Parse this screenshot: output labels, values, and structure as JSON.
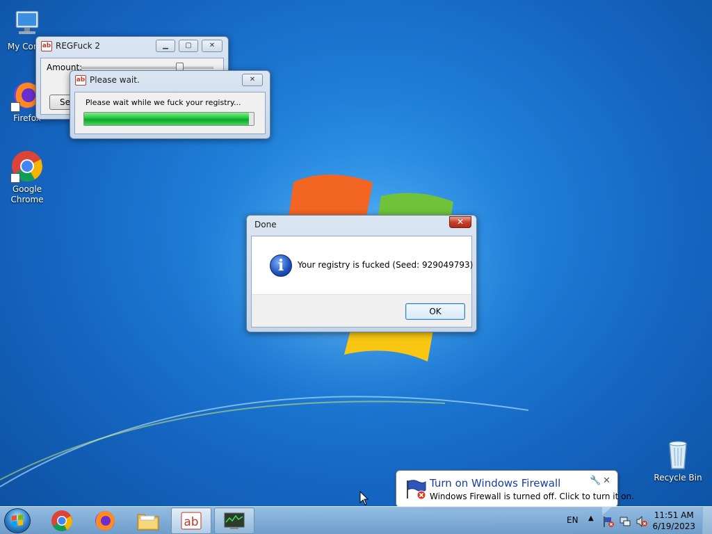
{
  "desktop": {
    "icons": [
      {
        "label": "My Comp",
        "icon": "computer-icon"
      },
      {
        "label": "Firefox",
        "icon": "firefox-icon"
      },
      {
        "label": "Google Chrome",
        "icon": "chrome-icon"
      },
      {
        "label": "Recycle Bin",
        "icon": "recycle-bin-icon"
      }
    ]
  },
  "regfuck_window": {
    "title": "REGFuck 2",
    "amount_label": "Amount:",
    "amount_level": 0.74,
    "settings_button": "Sett"
  },
  "please_wait_window": {
    "title": "Please wait.",
    "message": "Please wait while we fuck your registry...",
    "progress": 0.97
  },
  "done_dialog": {
    "title": "Done",
    "message": "Your registry is fucked (Seed: 929049793)",
    "ok_button": "OK",
    "close_symbol": "✕"
  },
  "notification": {
    "title": "Turn on Windows Firewall",
    "body": "Windows Firewall is turned off. Click to turn it on."
  },
  "taskbar": {
    "language": "EN",
    "time": "11:51 AM",
    "date": "6/19/2023",
    "pinned": [
      "chrome-icon",
      "firefox-icon",
      "explorer-icon",
      "regfuck-icon",
      "task-manager-icon"
    ]
  },
  "colors": {
    "progress_green": "#22c33a",
    "notification_title": "#1a3e9e",
    "close_red": "#c7402b"
  }
}
